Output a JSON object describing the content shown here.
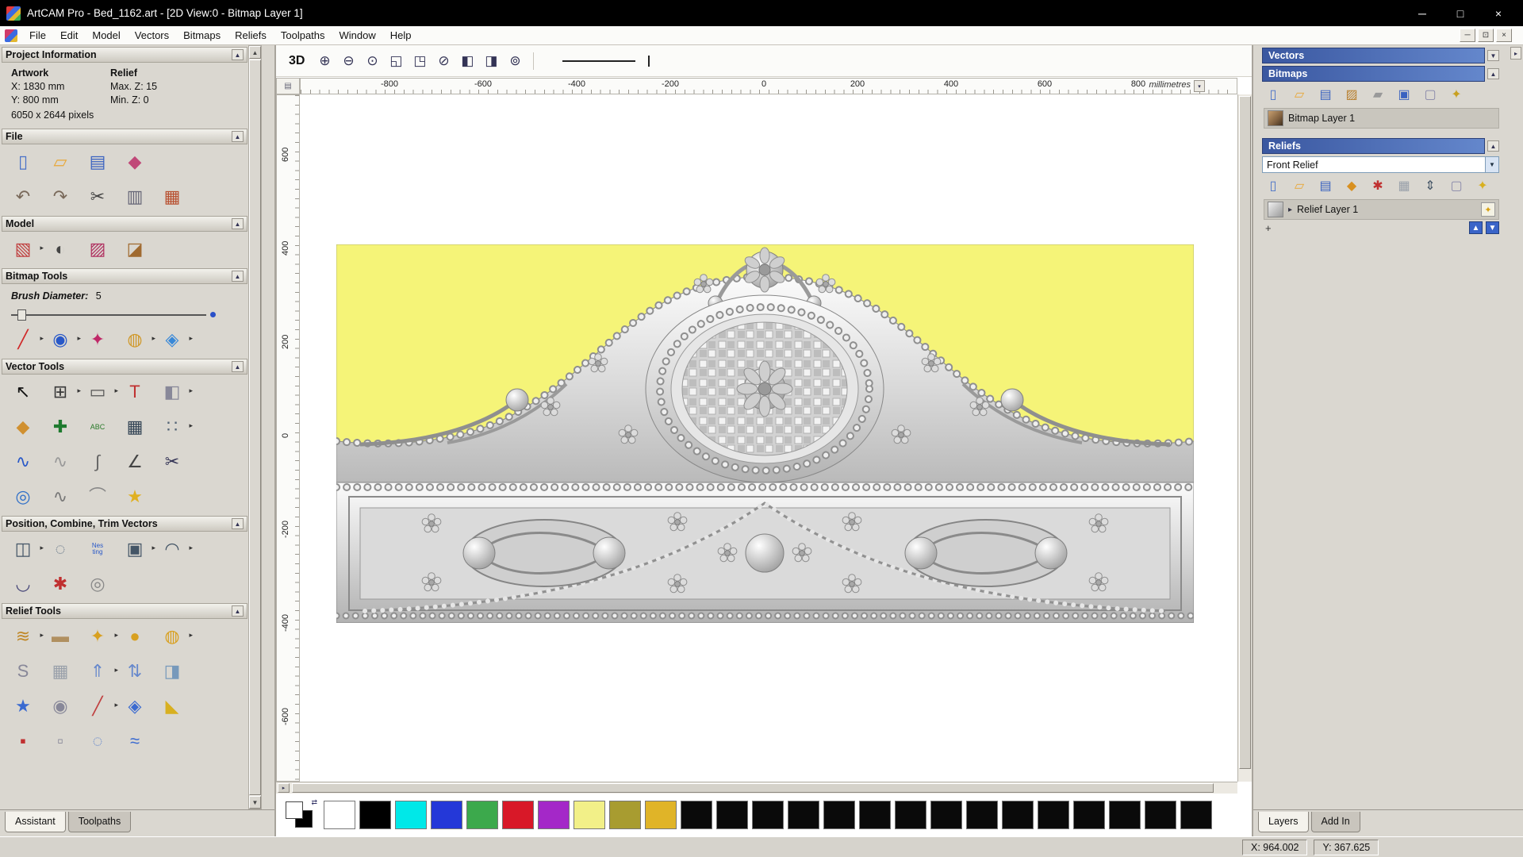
{
  "window": {
    "title": "ArtCAM Pro - Bed_1162.art - [2D View:0 - Bitmap Layer 1]"
  },
  "glyphs": {
    "up": "▲",
    "down": "▼",
    "right": "▸",
    "left": "◀",
    "min": "─",
    "max": "□",
    "restore": "⊡",
    "close": "×",
    "swap": "⇄",
    "plus": "+",
    "spin": "▾"
  },
  "menu": {
    "items": [
      "File",
      "Edit",
      "Model",
      "Vectors",
      "Bitmaps",
      "Reliefs",
      "Toolpaths",
      "Window",
      "Help"
    ]
  },
  "left": {
    "project": {
      "title": "Project Information",
      "artwork_label": "Artwork",
      "relief_label": "Relief",
      "x": "X: 1830 mm",
      "y": "Y: 800 mm",
      "max_z": "Max. Z: 15",
      "min_z": "Min. Z: 0",
      "pixels": "6050 x 2644 pixels"
    },
    "file": {
      "title": "File"
    },
    "model": {
      "title": "Model"
    },
    "bitmap": {
      "title": "Bitmap Tools",
      "brush_label": "Brush Diameter:",
      "brush_value": "5"
    },
    "vector": {
      "title": "Vector Tools"
    },
    "position": {
      "title": "Position, Combine, Trim Vectors"
    },
    "relief": {
      "title": "Relief Tools"
    },
    "tabs": {
      "assistant": "Assistant",
      "toolpaths": "Toolpaths"
    }
  },
  "icons": {
    "file_r1": [
      {
        "name": "new-model-icon",
        "glyph": "▯",
        "color": "#4a72c8"
      },
      {
        "name": "open-file-icon",
        "glyph": "▱",
        "color": "#e8a838"
      },
      {
        "name": "save-icon",
        "glyph": "▤",
        "color": "#3a62c0"
      },
      {
        "name": "import-export-icon",
        "glyph": "◆",
        "color": "#c04878"
      }
    ],
    "file_r2": [
      {
        "name": "undo-icon",
        "glyph": "↶",
        "color": "#79695a"
      },
      {
        "name": "redo-icon",
        "glyph": "↷",
        "color": "#79695a"
      },
      {
        "name": "cut-icon",
        "glyph": "✂",
        "color": "#444444"
      },
      {
        "name": "copy-icon",
        "glyph": "▥",
        "color": "#666677"
      },
      {
        "name": "paste-icon",
        "glyph": "▦",
        "color": "#b85030"
      }
    ],
    "model_r": [
      {
        "name": "set-model-size-icon",
        "glyph": "▧",
        "color": "#c04040",
        "arrow": true
      },
      {
        "name": "adjust-model-icon",
        "glyph": "◐",
        "color": "#444444"
      },
      {
        "name": "add-draft-icon",
        "glyph": "▨",
        "color": "#b03060"
      },
      {
        "name": "load-image-icon",
        "glyph": "◪",
        "color": "#a06a30"
      }
    ],
    "bitmap_r": [
      {
        "name": "paint-brush-icon",
        "glyph": "╱",
        "color": "#d02828",
        "arrow": true
      },
      {
        "name": "flood-fill-icon",
        "glyph": "◉",
        "color": "#2858c8",
        "arrow": true
      },
      {
        "name": "colour-picker-icon",
        "glyph": "✦",
        "color": "#c02868"
      },
      {
        "name": "palette-icon",
        "glyph": "◍",
        "color": "#d09828",
        "arrow": true
      },
      {
        "name": "reduce-colours-icon",
        "glyph": "◈",
        "color": "#3888d8",
        "arrow": true
      }
    ],
    "vector_r1": [
      {
        "name": "select-vectors-icon",
        "glyph": "↖",
        "color": "#111111"
      },
      {
        "name": "transform-vectors-icon",
        "glyph": "⊞",
        "color": "#3a3a3a",
        "arrow": true
      },
      {
        "name": "create-rectangle-icon",
        "glyph": "▭",
        "color": "#555555",
        "arrow": true
      },
      {
        "name": "create-text-icon",
        "glyph": "T",
        "color": "#c03030"
      },
      {
        "name": "mirror-vectors-icon",
        "glyph": "◧",
        "color": "#888899",
        "arrow": true
      }
    ],
    "vector_r2": [
      {
        "name": "wrap-vectors-icon",
        "glyph": "◆",
        "color": "#d09030"
      },
      {
        "name": "paste-along-curve-icon",
        "glyph": "✚",
        "color": "#1e7a2e"
      },
      {
        "name": "create-text-block-icon",
        "glyph": "ABC",
        "color": "#2a7a2a",
        "size": 9
      },
      {
        "name": "create-grid-icon",
        "glyph": "▦",
        "color": "#334455"
      },
      {
        "name": "snap-grid-icon",
        "glyph": "∷",
        "color": "#556677",
        "arrow": true
      }
    ],
    "vector_r3": [
      {
        "name": "create-polyline-icon",
        "glyph": "∿",
        "color": "#2858c8"
      },
      {
        "name": "smooth-polyline-icon",
        "glyph": "∿",
        "color": "#999999"
      },
      {
        "name": "create-arc-icon",
        "glyph": "∫",
        "color": "#666666"
      },
      {
        "name": "fit-arcs-icon",
        "glyph": "∠",
        "color": "#444444"
      },
      {
        "name": "trim-vectors-icon",
        "glyph": "✂",
        "color": "#333355"
      }
    ],
    "vector_r4": [
      {
        "name": "create-ring-icon",
        "glyph": "◎",
        "color": "#3070c8"
      },
      {
        "name": "sketch-polyline-icon",
        "glyph": "∿",
        "color": "#777777"
      },
      {
        "name": "pen-tool-icon",
        "glyph": "⌒",
        "color": "#888888"
      },
      {
        "name": "create-star-icon",
        "glyph": "★",
        "color": "#e0b020"
      }
    ],
    "position_r1": [
      {
        "name": "align-vectors-icon",
        "glyph": "◫",
        "color": "#445566",
        "arrow": true
      },
      {
        "name": "center-in-page-icon",
        "glyph": "◌",
        "color": "#667788"
      },
      {
        "name": "nesting-icon",
        "glyph": "Nes\nting",
        "color": "#2858c8",
        "size": 8
      },
      {
        "name": "block-copy-icon",
        "glyph": "▣",
        "color": "#445566",
        "arrow": true
      },
      {
        "name": "rotate-copy-icon",
        "glyph": "◠",
        "color": "#445566",
        "arrow": true
      }
    ],
    "position_r2": [
      {
        "name": "weld-vectors-icon",
        "glyph": "◡",
        "color": "#444477"
      },
      {
        "name": "trim-fillet-icon",
        "glyph": "✱",
        "color": "#c03030"
      },
      {
        "name": "slice-vectors-icon",
        "glyph": "◎",
        "color": "#888888"
      }
    ],
    "relief_r1": [
      {
        "name": "smooth-relief-icon",
        "glyph": "≋",
        "color": "#c08828",
        "arrow": true
      },
      {
        "name": "sculpt-icon",
        "glyph": "▬",
        "color": "#b09060"
      },
      {
        "name": "add-relief-icon",
        "glyph": "✦",
        "color": "#d8a020",
        "arrow": true
      },
      {
        "name": "shape-editor-icon",
        "glyph": "●",
        "color": "#d8a020"
      },
      {
        "name": "isolate-relief-icon",
        "glyph": "◍",
        "color": "#d8a020",
        "arrow": true
      }
    ],
    "relief_r2": [
      {
        "name": "sculpting-icon",
        "glyph": "S",
        "color": "#888899"
      },
      {
        "name": "weave-wizard-icon",
        "glyph": "▦",
        "color": "#99a0aa"
      },
      {
        "name": "offset-relief-icon",
        "glyph": "⇑",
        "color": "#6688cc",
        "arrow": true
      },
      {
        "name": "mirror-merge-icon",
        "glyph": "⇅",
        "color": "#6688cc"
      },
      {
        "name": "envelope-icon",
        "glyph": "◨",
        "color": "#7799bb"
      }
    ],
    "relief_r3": [
      {
        "name": "star-relief-icon",
        "glyph": "★",
        "color": "#3a6ad0"
      },
      {
        "name": "swirl-relief-icon",
        "glyph": "◉",
        "color": "#888899"
      },
      {
        "name": "smudge-relief-icon",
        "glyph": "╱",
        "color": "#c04040",
        "arrow": true
      },
      {
        "name": "texture-relief-icon",
        "glyph": "◈",
        "color": "#3a6ad0"
      },
      {
        "name": "angled-plane-icon",
        "glyph": "◣",
        "color": "#d8b020"
      }
    ],
    "relief_r4": [
      {
        "name": "extra-relief-tool-1-icon",
        "glyph": "▪",
        "color": "#c03030"
      },
      {
        "name": "extra-relief-tool-2-icon",
        "glyph": "▫",
        "color": "#888899"
      },
      {
        "name": "extra-relief-tool-3-icon",
        "glyph": "◌",
        "color": "#6688cc"
      },
      {
        "name": "extra-relief-tool-4-icon",
        "glyph": "≈",
        "color": "#3a6ad0"
      }
    ],
    "canvas_toolbar": [
      {
        "name": "zoom-in-icon",
        "glyph": "⊕",
        "color": "#333355"
      },
      {
        "name": "zoom-out-icon",
        "glyph": "⊖",
        "color": "#333355"
      },
      {
        "name": "zoom-object-icon",
        "glyph": "⊙",
        "color": "#333355"
      },
      {
        "name": "zoom-box-icon",
        "glyph": "◱",
        "color": "#333355"
      },
      {
        "name": "zoom-fit-icon",
        "glyph": "◳",
        "color": "#333355"
      },
      {
        "name": "zoom-previous-icon",
        "glyph": "⊘",
        "color": "#333355"
      },
      {
        "name": "page-preview-left-icon",
        "glyph": "◧",
        "color": "#333355"
      },
      {
        "name": "page-preview-right-icon",
        "glyph": "◨",
        "color": "#333355"
      },
      {
        "name": "zoom-100-icon",
        "glyph": "⊚",
        "color": "#333355"
      }
    ],
    "bitmaps_toolbar": [
      {
        "name": "new-bitmap-icon",
        "glyph": "▯",
        "color": "#4a72c8"
      },
      {
        "name": "open-bitmap-icon",
        "glyph": "▱",
        "color": "#e8a838"
      },
      {
        "name": "save-bitmap-icon",
        "glyph": "▤",
        "color": "#3a62c0"
      },
      {
        "name": "merge-bitmap-icon",
        "glyph": "▨",
        "color": "#b88030"
      },
      {
        "name": "paint-bitmap-icon",
        "glyph": "▰",
        "color": "#999999"
      },
      {
        "name": "edit-colours-icon",
        "glyph": "▣",
        "color": "#3a62c0"
      },
      {
        "name": "clear-bitmap-icon",
        "glyph": "▢",
        "color": "#8888aa"
      },
      {
        "name": "magic-wand-icon",
        "glyph": "✦",
        "color": "#c8a020"
      }
    ],
    "reliefs_toolbar": [
      {
        "name": "new-relief-icon",
        "glyph": "▯",
        "color": "#4a72c8"
      },
      {
        "name": "open-relief-icon",
        "glyph": "▱",
        "color": "#e8a838"
      },
      {
        "name": "save-relief-icon",
        "glyph": "▤",
        "color": "#3a62c0"
      },
      {
        "name": "smooth-relief-layer-icon",
        "glyph": "◆",
        "color": "#d89020"
      },
      {
        "name": "reset-relief-icon",
        "glyph": "✱",
        "color": "#c03030"
      },
      {
        "name": "greyscale-relief-icon",
        "glyph": "▦",
        "color": "#99a0aa"
      },
      {
        "name": "scale-relief-icon",
        "glyph": "⇕",
        "color": "#445566"
      },
      {
        "name": "delete-relief-icon",
        "glyph": "▢",
        "color": "#8888aa"
      },
      {
        "name": "preview-relief-icon",
        "glyph": "✦",
        "color": "#d8b020"
      }
    ]
  },
  "canvas": {
    "toolbar": {
      "view3d": "3D"
    },
    "ruler": {
      "h": [
        "-800",
        "-600",
        "-400",
        "-200",
        "0",
        "200",
        "400",
        "600",
        "800"
      ],
      "v": [
        "600",
        "400",
        "200",
        "0",
        "-200",
        "-400",
        "-600"
      ],
      "units": "millimetres"
    }
  },
  "artwork": {
    "background": "#f5f478",
    "relief_light": "#fafafa",
    "relief_dark": "#b9b9b9"
  },
  "palette": {
    "swatches": [
      "#ffffff",
      "#000000",
      "#00e8e8",
      "#2438d8",
      "#3ca94c",
      "#d81828",
      "#a428c8",
      "#f2f088",
      "#a89c30",
      "#e0b428",
      "#0a0a0a",
      "#0a0a0a",
      "#0a0a0a",
      "#0a0a0a",
      "#0a0a0a",
      "#0a0a0a",
      "#0a0a0a",
      "#0a0a0a",
      "#0a0a0a",
      "#0a0a0a",
      "#0a0a0a",
      "#0a0a0a",
      "#0a0a0a",
      "#0a0a0a",
      "#0a0a0a"
    ]
  },
  "right": {
    "vectors": {
      "title": "Vectors"
    },
    "bitmaps": {
      "title": "Bitmaps",
      "layer": "Bitmap Layer 1"
    },
    "reliefs": {
      "title": "Reliefs",
      "selected": "Front Relief",
      "layer": "Relief Layer 1",
      "add_label": "+"
    },
    "tabs": {
      "layers": "Layers",
      "addin": "Add In"
    }
  },
  "status": {
    "x": "X: 964.002",
    "y": "Y: 367.625"
  }
}
